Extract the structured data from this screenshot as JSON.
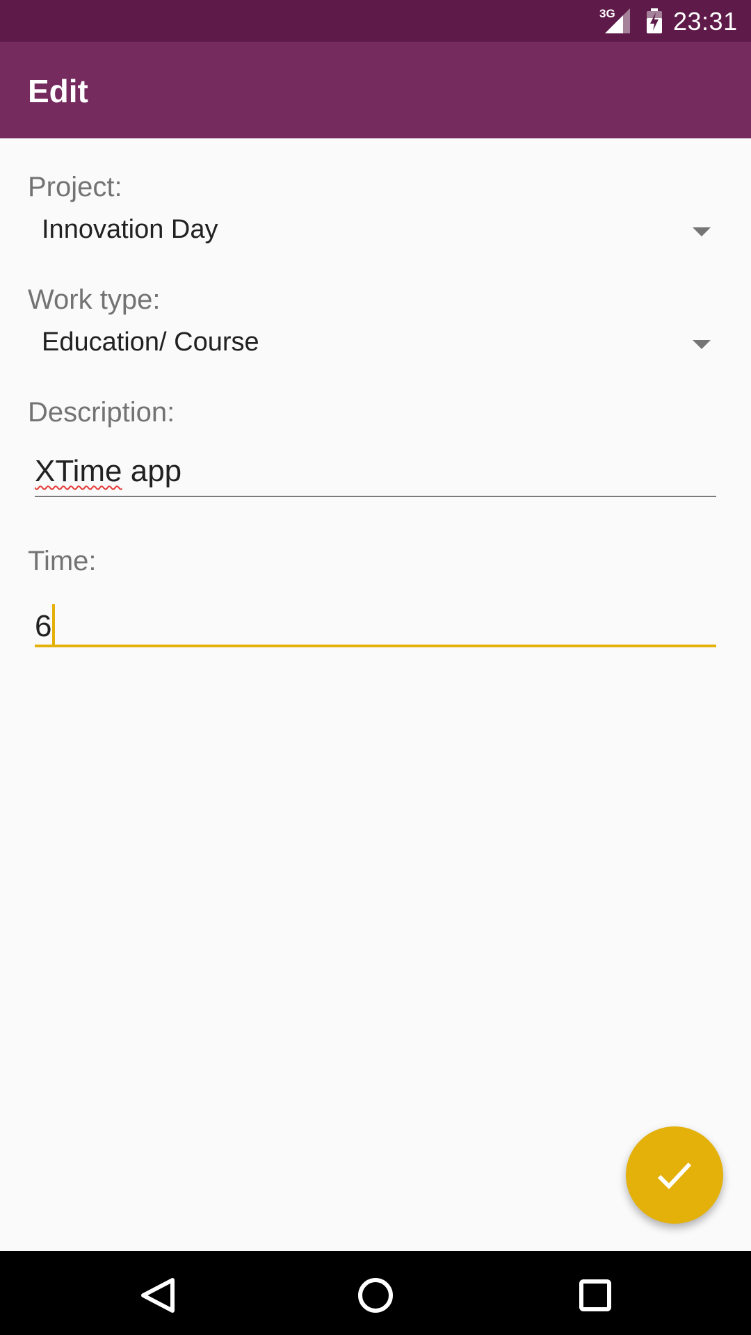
{
  "status_bar": {
    "network_label": "3G",
    "time": "23:31",
    "icons": [
      "signal-icon",
      "battery-icon"
    ]
  },
  "app_bar": {
    "title": "Edit"
  },
  "form": {
    "project": {
      "label": "Project:",
      "value": "Innovation Day"
    },
    "work_type": {
      "label": "Work type:",
      "value": "Education/ Course"
    },
    "description": {
      "label": "Description:",
      "value_misspelled": "XTime",
      "value_rest": " app"
    },
    "time": {
      "label": "Time:",
      "value": "6"
    }
  },
  "fab": {
    "icon": "check-icon"
  },
  "nav_bar": {
    "icons": [
      "back-icon",
      "home-icon",
      "recents-icon"
    ]
  },
  "colors": {
    "status_bar": "#5e1a48",
    "app_bar": "#752b5e",
    "accent": "#e4b00a"
  }
}
